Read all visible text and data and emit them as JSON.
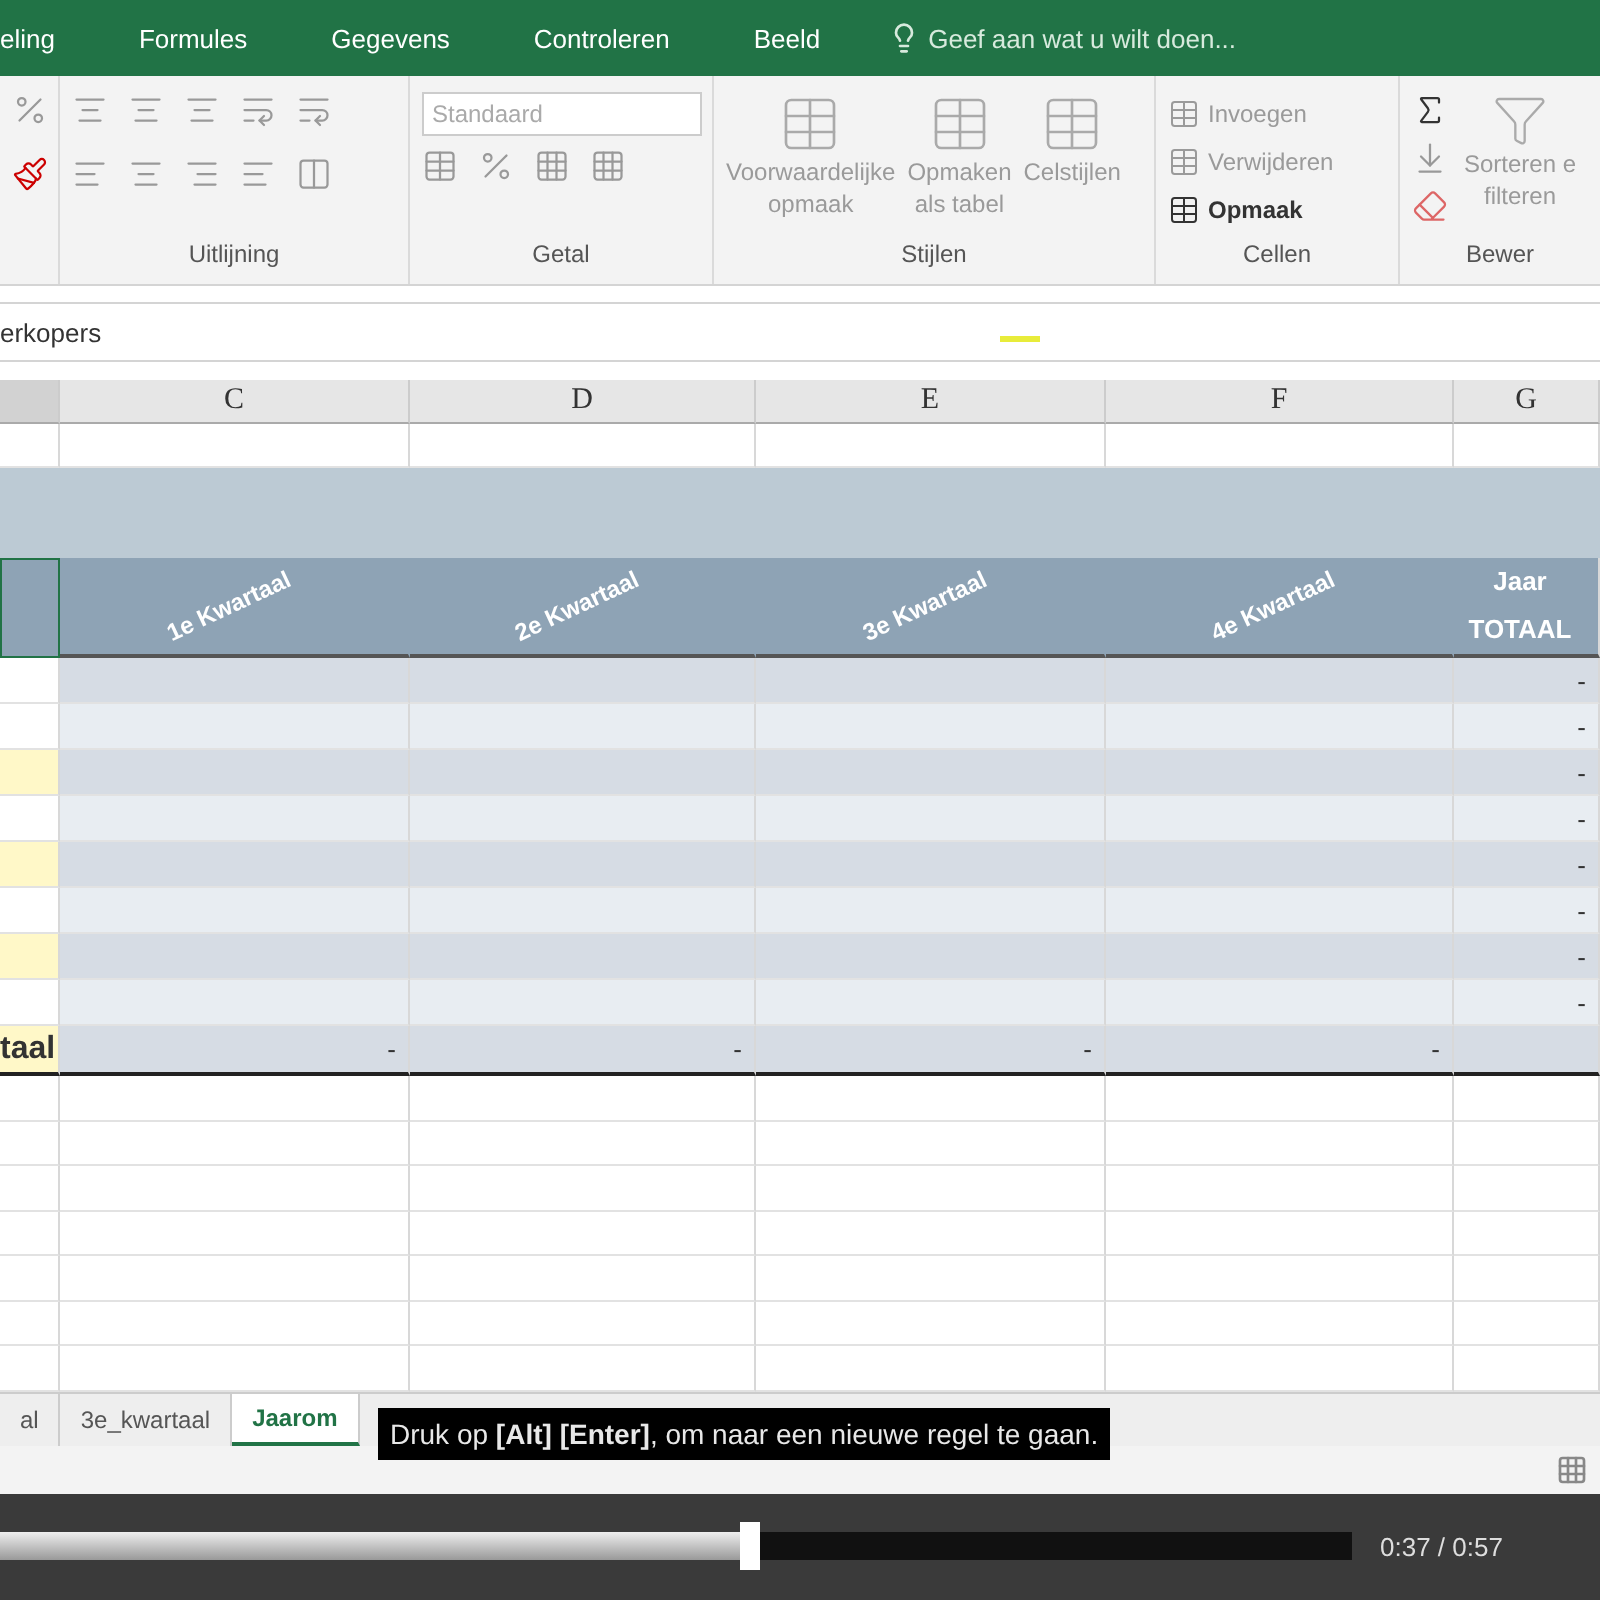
{
  "ribbon_tabs": [
    {
      "label": "eling",
      "selected": false
    },
    {
      "label": "Formules",
      "selected": false
    },
    {
      "label": "Gegevens",
      "selected": false
    },
    {
      "label": "Controleren",
      "selected": false
    },
    {
      "label": "Beeld",
      "selected": false
    }
  ],
  "tell_me": {
    "placeholder": "Geef aan wat u wilt doen..."
  },
  "ribbon_groups": [
    {
      "kind": "font"
    },
    {
      "kind": "alignment",
      "label": "Uitlijning"
    },
    {
      "kind": "number",
      "label": "Getal",
      "format": "Standaard"
    },
    {
      "kind": "styles",
      "label": "Stijlen",
      "buttons": [
        {
          "lines": [
            "Voorwaardelijke",
            "opmaak"
          ],
          "disabled": true
        },
        {
          "lines": [
            "Opmaken",
            "als tabel"
          ],
          "disabled": true
        },
        {
          "lines": [
            "Celstijlen"
          ],
          "disabled": true
        }
      ]
    },
    {
      "kind": "cells",
      "label": "Cellen",
      "buttons": [
        {
          "label": "Invoegen",
          "disabled": true
        },
        {
          "label": "Verwijderen",
          "disabled": true
        },
        {
          "label": "Opmaak",
          "disabled": false
        }
      ]
    },
    {
      "kind": "editing",
      "label": "Bewer",
      "sort": [
        "Sorteren e",
        "filteren"
      ]
    }
  ],
  "formula_bar": {
    "value": "erkopers"
  },
  "columns": [
    {
      "selected": true
    },
    {
      "label": "C",
      "selected": false
    },
    {
      "label": "D",
      "selected": false
    },
    {
      "label": "E",
      "selected": false
    },
    {
      "label": "F",
      "selected": false
    },
    {
      "label": "G",
      "selected": false
    }
  ],
  "header_row": {
    "quarters": [
      "1e Kwartaal",
      "2e Kwartaal",
      "3e Kwartaal",
      "4e Kwartaal"
    ],
    "total": [
      "Jaar",
      "TOTAAL"
    ]
  },
  "data_rows": [
    {
      "highlight": false,
      "total": "-"
    },
    {
      "highlight": false,
      "total": "-"
    },
    {
      "highlight": true,
      "total": "-"
    },
    {
      "highlight": false,
      "total": "-"
    },
    {
      "highlight": true,
      "total": "-"
    },
    {
      "highlight": false,
      "total": "-"
    },
    {
      "highlight": true,
      "total": "-"
    },
    {
      "highlight": false,
      "total": "-"
    }
  ],
  "total_row": {
    "label": "taal",
    "values": [
      "-",
      "-",
      "-",
      "-"
    ]
  },
  "sheet_tabs": [
    {
      "label": "al",
      "selected": false
    },
    {
      "label": "3e_kwartaal",
      "selected": false
    },
    {
      "label": "Jaarom",
      "selected": true
    }
  ],
  "caption": "Druk op **[Alt]** **[Enter]**, om naar een nieuwe regel te gaan.",
  "player": {
    "level": 0.555,
    "time": "0:37 / 0:57"
  }
}
